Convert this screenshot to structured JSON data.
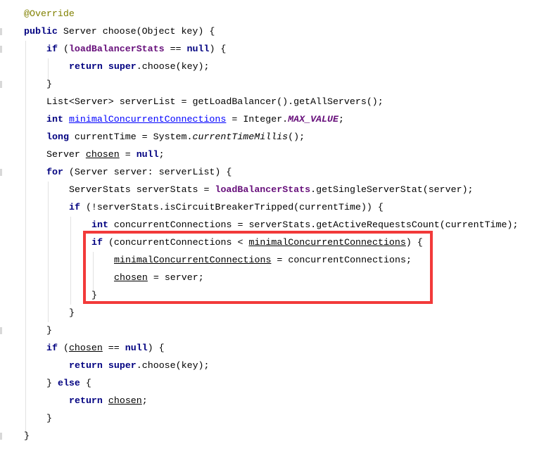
{
  "editor": {
    "highlight_color": "#f23a3a",
    "lines": [
      {
        "indent": 0,
        "tokens": [
          [
            "@Override",
            "ann"
          ]
        ]
      },
      {
        "indent": 0,
        "tokens": [
          [
            "public",
            "kw"
          ],
          [
            " Server choose(Object key) {",
            ""
          ]
        ]
      },
      {
        "indent": 1,
        "tokens": [
          [
            "if",
            "kw"
          ],
          [
            " (",
            ""
          ],
          [
            "loadBalancerStats",
            "fld"
          ],
          [
            " == ",
            ""
          ],
          [
            "null",
            "kw"
          ],
          [
            ") {",
            ""
          ]
        ]
      },
      {
        "indent": 2,
        "tokens": [
          [
            "return",
            "kw"
          ],
          [
            " ",
            ""
          ],
          [
            "super",
            "kw"
          ],
          [
            ".choose(key);",
            ""
          ]
        ]
      },
      {
        "indent": 1,
        "tokens": [
          [
            "}",
            ""
          ]
        ]
      },
      {
        "indent": 1,
        "tokens": [
          [
            "List<Server> serverList = getLoadBalancer().getAllServers();",
            ""
          ]
        ]
      },
      {
        "indent": 1,
        "tokens": [
          [
            "int",
            "kw"
          ],
          [
            " ",
            ""
          ],
          [
            "minimalConcurrentConnections",
            "ub"
          ],
          [
            " = Integer.",
            ""
          ],
          [
            "MAX_VALUE",
            "cst"
          ],
          [
            ";",
            ""
          ]
        ]
      },
      {
        "indent": 1,
        "tokens": [
          [
            "long",
            "kw"
          ],
          [
            " currentTime = System.",
            ""
          ],
          [
            "currentTimeMillis",
            "it"
          ],
          [
            "();",
            ""
          ]
        ]
      },
      {
        "indent": 1,
        "tokens": [
          [
            "Server ",
            ""
          ],
          [
            "chosen",
            "u"
          ],
          [
            " = ",
            ""
          ],
          [
            "null",
            "kw"
          ],
          [
            ";",
            ""
          ]
        ]
      },
      {
        "indent": 1,
        "tokens": [
          [
            "for",
            "kw"
          ],
          [
            " (Server server: serverList) {",
            ""
          ]
        ]
      },
      {
        "indent": 2,
        "tokens": [
          [
            "ServerStats serverStats = ",
            ""
          ],
          [
            "loadBalancerStats",
            "fld"
          ],
          [
            ".getSingleServerStat(server);",
            ""
          ]
        ]
      },
      {
        "indent": 2,
        "tokens": [
          [
            "if",
            "kw"
          ],
          [
            " (!serverStats.isCircuitBreakerTripped(currentTime)) {",
            ""
          ]
        ]
      },
      {
        "indent": 3,
        "tokens": [
          [
            "int",
            "kw"
          ],
          [
            " concurrentConnections = serverStats.getActiveRequestsCount(currentTime);",
            ""
          ]
        ]
      },
      {
        "indent": 3,
        "tokens": [
          [
            "if",
            "kw"
          ],
          [
            " (concurrentConnections < ",
            ""
          ],
          [
            "minimalConcurrentConnections",
            "u"
          ],
          [
            ") {",
            ""
          ]
        ]
      },
      {
        "indent": 4,
        "tokens": [
          [
            "minimalConcurrentConnections",
            "u"
          ],
          [
            " = concurrentConnections;",
            ""
          ]
        ]
      },
      {
        "indent": 4,
        "tokens": [
          [
            "chosen",
            "u"
          ],
          [
            " = server;",
            ""
          ]
        ]
      },
      {
        "indent": 3,
        "tokens": [
          [
            "}",
            ""
          ]
        ]
      },
      {
        "indent": 2,
        "tokens": [
          [
            "}",
            ""
          ]
        ]
      },
      {
        "indent": 1,
        "tokens": [
          [
            "}",
            ""
          ]
        ]
      },
      {
        "indent": 1,
        "tokens": [
          [
            "if",
            "kw"
          ],
          [
            " (",
            ""
          ],
          [
            "chosen",
            "u"
          ],
          [
            " == ",
            ""
          ],
          [
            "null",
            "kw"
          ],
          [
            ") {",
            ""
          ]
        ]
      },
      {
        "indent": 2,
        "tokens": [
          [
            "return",
            "kw"
          ],
          [
            " ",
            ""
          ],
          [
            "super",
            "kw"
          ],
          [
            ".choose(key);",
            ""
          ]
        ]
      },
      {
        "indent": 1,
        "tokens": [
          [
            "} ",
            ""
          ],
          [
            "else",
            "kw"
          ],
          [
            " {",
            ""
          ]
        ]
      },
      {
        "indent": 2,
        "tokens": [
          [
            "return",
            "kw"
          ],
          [
            " ",
            ""
          ],
          [
            "chosen",
            "u"
          ],
          [
            ";",
            ""
          ]
        ]
      },
      {
        "indent": 1,
        "tokens": [
          [
            "}",
            ""
          ]
        ]
      },
      {
        "indent": 0,
        "tokens": [
          [
            "}",
            ""
          ]
        ]
      }
    ]
  }
}
